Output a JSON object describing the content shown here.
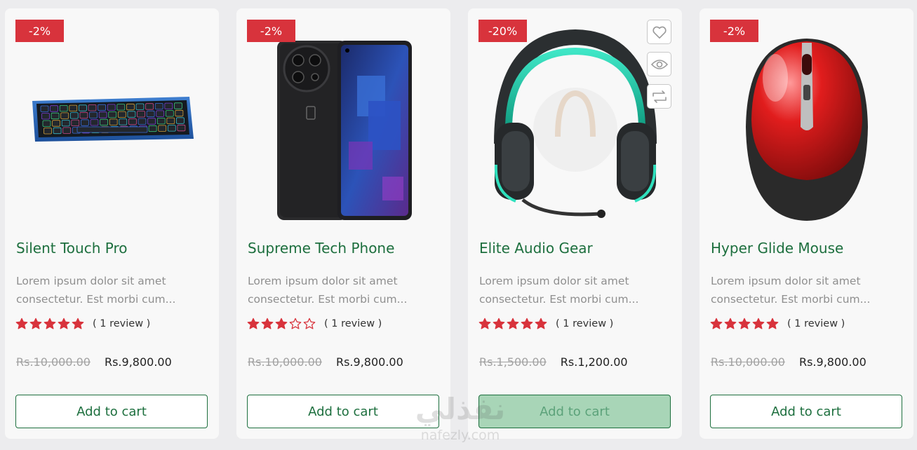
{
  "products": [
    {
      "badge": "-2%",
      "image": "keyboard-image",
      "title": "Silent Touch Pro",
      "desc_line1": "Lorem ipsum dolor sit amet",
      "desc_line2": "consectetur. Est morbi cum...",
      "rating": 5,
      "reviews": "( 1 review )",
      "old_price": "Rs.10,000.00",
      "new_price": "Rs.9,800.00",
      "cart_label": "Add to cart"
    },
    {
      "badge": "-2%",
      "image": "phone-image",
      "title": "Supreme Tech Phone",
      "desc_line1": "Lorem ipsum dolor sit amet",
      "desc_line2": "consectetur. Est morbi cum...",
      "rating": 3,
      "reviews": "( 1 review )",
      "old_price": "Rs.10,000.00",
      "new_price": "Rs.9,800.00",
      "cart_label": "Add to cart"
    },
    {
      "badge": "-20%",
      "image": "headphones-image",
      "title": "Elite Audio Gear",
      "desc_line1": "Lorem ipsum dolor sit amet",
      "desc_line2": "consectetur. Est morbi cum...",
      "rating": 5,
      "reviews": "( 1 review )",
      "old_price": "Rs.1,500.00",
      "new_price": "Rs.1,200.00",
      "cart_label": "Add to cart",
      "hover_actions": [
        "heart-icon",
        "eye-icon",
        "compare-icon"
      ]
    },
    {
      "badge": "-2%",
      "image": "mouse-image",
      "title": "Hyper Glide Mouse",
      "desc_line1": "Lorem ipsum dolor sit amet",
      "desc_line2": "consectetur. Est morbi cum...",
      "rating": 5,
      "reviews": "( 1 review )",
      "old_price": "Rs.10,000.00",
      "new_price": "Rs.9,800.00",
      "cart_label": "Add to cart"
    }
  ],
  "watermark": {
    "arabic": "نفذلي",
    "latin": "nafezly.com"
  },
  "colors": {
    "brand_green": "#1d6f3e",
    "badge_red": "#d8333c",
    "star_red": "#d8333c"
  }
}
